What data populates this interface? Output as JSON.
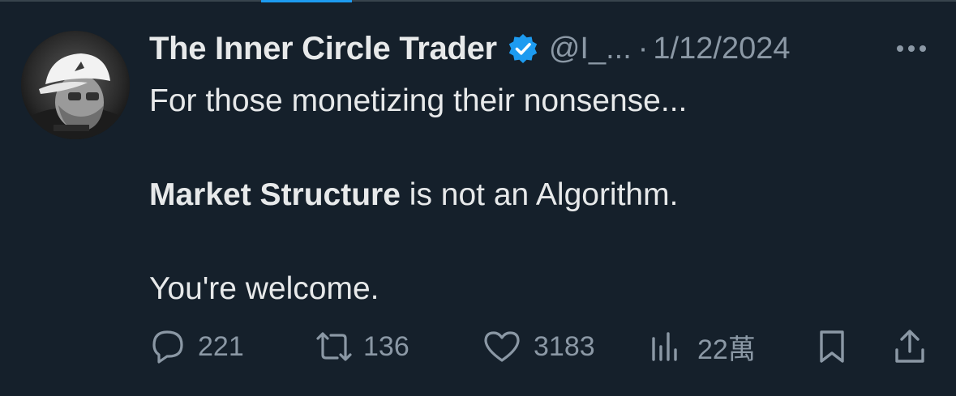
{
  "tweet": {
    "author": {
      "display_name": "The Inner Circle Trader",
      "handle": "@I_...",
      "verified": true
    },
    "separator": "·",
    "date": "1/12/2024",
    "body": {
      "line1": "For those monetizing their nonsense...",
      "line2_bold": "Market Structure",
      "line2_rest": " is not an Algorithm.",
      "line3": "You're welcome."
    },
    "actions": {
      "replies": "221",
      "reposts": "136",
      "likes": "3183",
      "views": "22萬"
    }
  },
  "colors": {
    "background": "#15202b",
    "text_primary": "#e7e9ea",
    "text_secondary": "#8b98a5",
    "accent": "#1d9bf0",
    "divider": "#38444d"
  },
  "icons": {
    "verified": "verified-badge-icon",
    "more": "more-options-icon",
    "reply": "reply-icon",
    "repost": "repost-icon",
    "like": "heart-icon",
    "views": "views-chart-icon",
    "bookmark": "bookmark-icon",
    "share": "share-icon"
  }
}
